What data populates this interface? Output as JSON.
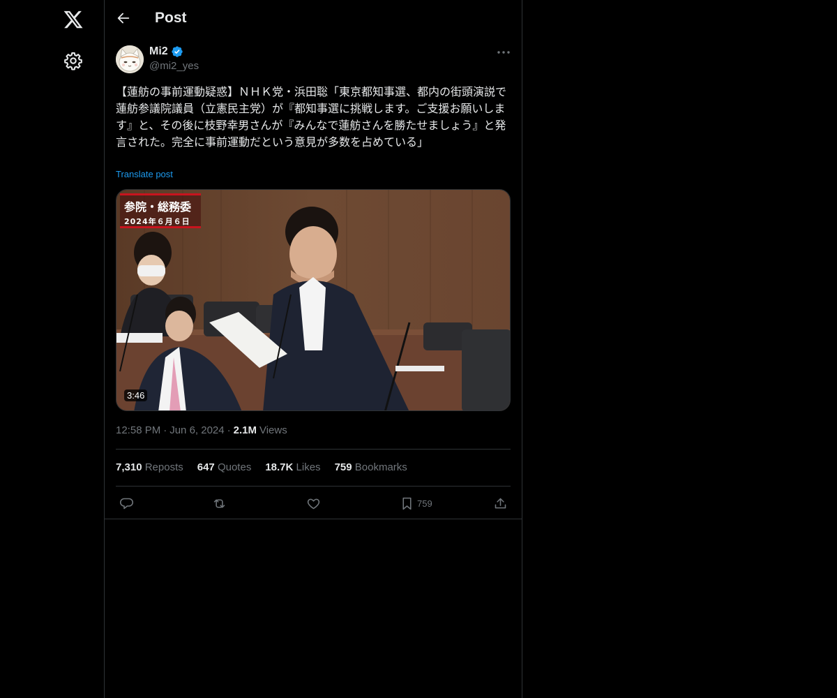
{
  "header": {
    "title": "Post"
  },
  "author": {
    "display_name": "Mi2",
    "handle": "@mi2_yes"
  },
  "post": {
    "text": "【蓮舫の事前運動疑惑】ＮＨＫ党・浜田聡「東京都知事選、都内の街頭演説で蓮舫参議院議員（立憲民主党）が『都知事選に挑戦します。ご支援お願いします』と、その後に枝野幸男さんが『みんなで蓮舫さんを勝たせましょう』と発言された。完全に事前運動だという意見が多数を占めている」",
    "translate_label": "Translate post",
    "media": {
      "tag_title": "参院・総務委",
      "tag_date": "2024年６月６日",
      "duration": "3:46"
    },
    "time": "12:58 PM",
    "separator": "·",
    "date": "Jun 6, 2024",
    "views_count": "2.1M",
    "views_label": "Views"
  },
  "stats": [
    {
      "num": "7,310",
      "label": "Reposts"
    },
    {
      "num": "647",
      "label": "Quotes"
    },
    {
      "num": "18.7K",
      "label": "Likes"
    },
    {
      "num": "759",
      "label": "Bookmarks"
    }
  ],
  "actions": {
    "bookmark_count": "759"
  },
  "colors": {
    "background": "#000000",
    "text_primary": "#e7e9ea",
    "text_secondary": "#71767b",
    "accent": "#1d9bf0",
    "border": "#2f3336"
  },
  "icons": [
    "x-logo-icon",
    "gear-icon",
    "back-arrow-icon",
    "verified-badge-icon",
    "more-options-icon",
    "reply-icon",
    "repost-icon",
    "like-icon",
    "bookmark-icon",
    "share-icon"
  ]
}
